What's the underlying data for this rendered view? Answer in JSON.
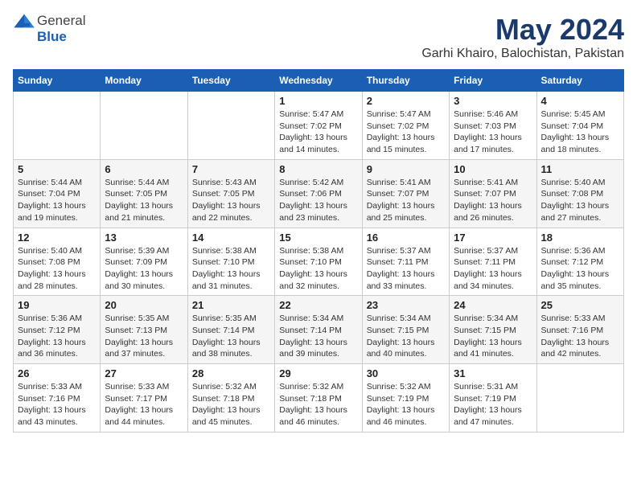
{
  "logo": {
    "general": "General",
    "blue": "Blue"
  },
  "title": "May 2024",
  "location": "Garhi Khairo, Balochistan, Pakistan",
  "weekdays": [
    "Sunday",
    "Monday",
    "Tuesday",
    "Wednesday",
    "Thursday",
    "Friday",
    "Saturday"
  ],
  "weeks": [
    [
      {
        "day": "",
        "info": ""
      },
      {
        "day": "",
        "info": ""
      },
      {
        "day": "",
        "info": ""
      },
      {
        "day": "1",
        "info": "Sunrise: 5:47 AM\nSunset: 7:02 PM\nDaylight: 13 hours and 14 minutes."
      },
      {
        "day": "2",
        "info": "Sunrise: 5:47 AM\nSunset: 7:02 PM\nDaylight: 13 hours and 15 minutes."
      },
      {
        "day": "3",
        "info": "Sunrise: 5:46 AM\nSunset: 7:03 PM\nDaylight: 13 hours and 17 minutes."
      },
      {
        "day": "4",
        "info": "Sunrise: 5:45 AM\nSunset: 7:04 PM\nDaylight: 13 hours and 18 minutes."
      }
    ],
    [
      {
        "day": "5",
        "info": "Sunrise: 5:44 AM\nSunset: 7:04 PM\nDaylight: 13 hours and 19 minutes."
      },
      {
        "day": "6",
        "info": "Sunrise: 5:44 AM\nSunset: 7:05 PM\nDaylight: 13 hours and 21 minutes."
      },
      {
        "day": "7",
        "info": "Sunrise: 5:43 AM\nSunset: 7:05 PM\nDaylight: 13 hours and 22 minutes."
      },
      {
        "day": "8",
        "info": "Sunrise: 5:42 AM\nSunset: 7:06 PM\nDaylight: 13 hours and 23 minutes."
      },
      {
        "day": "9",
        "info": "Sunrise: 5:41 AM\nSunset: 7:07 PM\nDaylight: 13 hours and 25 minutes."
      },
      {
        "day": "10",
        "info": "Sunrise: 5:41 AM\nSunset: 7:07 PM\nDaylight: 13 hours and 26 minutes."
      },
      {
        "day": "11",
        "info": "Sunrise: 5:40 AM\nSunset: 7:08 PM\nDaylight: 13 hours and 27 minutes."
      }
    ],
    [
      {
        "day": "12",
        "info": "Sunrise: 5:40 AM\nSunset: 7:08 PM\nDaylight: 13 hours and 28 minutes."
      },
      {
        "day": "13",
        "info": "Sunrise: 5:39 AM\nSunset: 7:09 PM\nDaylight: 13 hours and 30 minutes."
      },
      {
        "day": "14",
        "info": "Sunrise: 5:38 AM\nSunset: 7:10 PM\nDaylight: 13 hours and 31 minutes."
      },
      {
        "day": "15",
        "info": "Sunrise: 5:38 AM\nSunset: 7:10 PM\nDaylight: 13 hours and 32 minutes."
      },
      {
        "day": "16",
        "info": "Sunrise: 5:37 AM\nSunset: 7:11 PM\nDaylight: 13 hours and 33 minutes."
      },
      {
        "day": "17",
        "info": "Sunrise: 5:37 AM\nSunset: 7:11 PM\nDaylight: 13 hours and 34 minutes."
      },
      {
        "day": "18",
        "info": "Sunrise: 5:36 AM\nSunset: 7:12 PM\nDaylight: 13 hours and 35 minutes."
      }
    ],
    [
      {
        "day": "19",
        "info": "Sunrise: 5:36 AM\nSunset: 7:12 PM\nDaylight: 13 hours and 36 minutes."
      },
      {
        "day": "20",
        "info": "Sunrise: 5:35 AM\nSunset: 7:13 PM\nDaylight: 13 hours and 37 minutes."
      },
      {
        "day": "21",
        "info": "Sunrise: 5:35 AM\nSunset: 7:14 PM\nDaylight: 13 hours and 38 minutes."
      },
      {
        "day": "22",
        "info": "Sunrise: 5:34 AM\nSunset: 7:14 PM\nDaylight: 13 hours and 39 minutes."
      },
      {
        "day": "23",
        "info": "Sunrise: 5:34 AM\nSunset: 7:15 PM\nDaylight: 13 hours and 40 minutes."
      },
      {
        "day": "24",
        "info": "Sunrise: 5:34 AM\nSunset: 7:15 PM\nDaylight: 13 hours and 41 minutes."
      },
      {
        "day": "25",
        "info": "Sunrise: 5:33 AM\nSunset: 7:16 PM\nDaylight: 13 hours and 42 minutes."
      }
    ],
    [
      {
        "day": "26",
        "info": "Sunrise: 5:33 AM\nSunset: 7:16 PM\nDaylight: 13 hours and 43 minutes."
      },
      {
        "day": "27",
        "info": "Sunrise: 5:33 AM\nSunset: 7:17 PM\nDaylight: 13 hours and 44 minutes."
      },
      {
        "day": "28",
        "info": "Sunrise: 5:32 AM\nSunset: 7:18 PM\nDaylight: 13 hours and 45 minutes."
      },
      {
        "day": "29",
        "info": "Sunrise: 5:32 AM\nSunset: 7:18 PM\nDaylight: 13 hours and 46 minutes."
      },
      {
        "day": "30",
        "info": "Sunrise: 5:32 AM\nSunset: 7:19 PM\nDaylight: 13 hours and 46 minutes."
      },
      {
        "day": "31",
        "info": "Sunrise: 5:31 AM\nSunset: 7:19 PM\nDaylight: 13 hours and 47 minutes."
      },
      {
        "day": "",
        "info": ""
      }
    ]
  ]
}
